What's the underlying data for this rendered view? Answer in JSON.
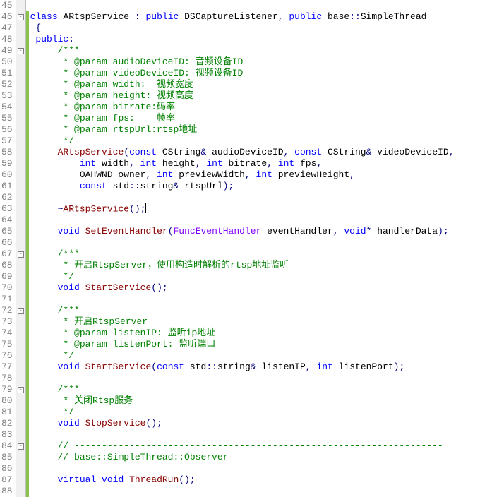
{
  "lines": [
    {
      "num": "45",
      "changed": false,
      "fold": "",
      "tokens": []
    },
    {
      "num": "46",
      "changed": true,
      "fold": "-",
      "tokens": [
        {
          "c": "kw",
          "t": "class"
        },
        {
          "c": "txt",
          "t": " "
        },
        {
          "c": "cls",
          "t": "ARtspService"
        },
        {
          "c": "txt",
          "t": " "
        },
        {
          "c": "op",
          "t": ":"
        },
        {
          "c": "txt",
          "t": " "
        },
        {
          "c": "kw",
          "t": "public"
        },
        {
          "c": "txt",
          "t": " "
        },
        {
          "c": "cls",
          "t": "DSCaptureListener"
        },
        {
          "c": "op",
          "t": ","
        },
        {
          "c": "txt",
          "t": " "
        },
        {
          "c": "kw",
          "t": "public"
        },
        {
          "c": "txt",
          "t": " base"
        },
        {
          "c": "op",
          "t": "::"
        },
        {
          "c": "cls",
          "t": "SimpleThread"
        }
      ]
    },
    {
      "num": "47",
      "changed": true,
      "fold": "",
      "tokens": [
        {
          "c": "txt",
          "t": " "
        },
        {
          "c": "op",
          "t": "{"
        }
      ]
    },
    {
      "num": "48",
      "changed": true,
      "fold": "",
      "tokens": [
        {
          "c": "txt",
          "t": " "
        },
        {
          "c": "kw",
          "t": "public"
        },
        {
          "c": "op",
          "t": ":"
        }
      ]
    },
    {
      "num": "49",
      "changed": true,
      "fold": "-",
      "tokens": [
        {
          "c": "txt",
          "t": "     "
        },
        {
          "c": "comment",
          "t": "/***"
        }
      ]
    },
    {
      "num": "50",
      "changed": true,
      "fold": "",
      "tokens": [
        {
          "c": "txt",
          "t": "     "
        },
        {
          "c": "comment",
          "t": " * @param audioDeviceID: 音频设备ID"
        }
      ]
    },
    {
      "num": "51",
      "changed": true,
      "fold": "",
      "tokens": [
        {
          "c": "txt",
          "t": "     "
        },
        {
          "c": "comment",
          "t": " * @param videoDeviceID: 视频设备ID"
        }
      ]
    },
    {
      "num": "52",
      "changed": true,
      "fold": "",
      "tokens": [
        {
          "c": "txt",
          "t": "     "
        },
        {
          "c": "comment",
          "t": " * @param width:  视频宽度"
        }
      ]
    },
    {
      "num": "53",
      "changed": true,
      "fold": "",
      "tokens": [
        {
          "c": "txt",
          "t": "     "
        },
        {
          "c": "comment",
          "t": " * @param height: 视频高度"
        }
      ]
    },
    {
      "num": "54",
      "changed": true,
      "fold": "",
      "tokens": [
        {
          "c": "txt",
          "t": "     "
        },
        {
          "c": "comment",
          "t": " * @param bitrate:码率"
        }
      ]
    },
    {
      "num": "55",
      "changed": true,
      "fold": "",
      "tokens": [
        {
          "c": "txt",
          "t": "     "
        },
        {
          "c": "comment",
          "t": " * @param fps:    帧率"
        }
      ]
    },
    {
      "num": "56",
      "changed": true,
      "fold": "",
      "tokens": [
        {
          "c": "txt",
          "t": "     "
        },
        {
          "c": "comment",
          "t": " * @param rtspUrl:rtsp地址"
        }
      ]
    },
    {
      "num": "57",
      "changed": true,
      "fold": "",
      "tokens": [
        {
          "c": "txt",
          "t": "     "
        },
        {
          "c": "comment",
          "t": " */"
        }
      ]
    },
    {
      "num": "58",
      "changed": true,
      "fold": "",
      "tokens": [
        {
          "c": "txt",
          "t": "     "
        },
        {
          "c": "func",
          "t": "ARtspService"
        },
        {
          "c": "op",
          "t": "("
        },
        {
          "c": "kw",
          "t": "const"
        },
        {
          "c": "txt",
          "t": " CString"
        },
        {
          "c": "op",
          "t": "&"
        },
        {
          "c": "txt",
          "t": " audioDeviceID"
        },
        {
          "c": "op",
          "t": ","
        },
        {
          "c": "txt",
          "t": " "
        },
        {
          "c": "kw",
          "t": "const"
        },
        {
          "c": "txt",
          "t": " CString"
        },
        {
          "c": "op",
          "t": "&"
        },
        {
          "c": "txt",
          "t": " videoDeviceID"
        },
        {
          "c": "op",
          "t": ","
        }
      ]
    },
    {
      "num": "59",
      "changed": true,
      "fold": "",
      "tokens": [
        {
          "c": "txt",
          "t": "         "
        },
        {
          "c": "kw",
          "t": "int"
        },
        {
          "c": "txt",
          "t": " width"
        },
        {
          "c": "op",
          "t": ","
        },
        {
          "c": "txt",
          "t": " "
        },
        {
          "c": "kw",
          "t": "int"
        },
        {
          "c": "txt",
          "t": " height"
        },
        {
          "c": "op",
          "t": ","
        },
        {
          "c": "txt",
          "t": " "
        },
        {
          "c": "kw",
          "t": "int"
        },
        {
          "c": "txt",
          "t": " bitrate"
        },
        {
          "c": "op",
          "t": ","
        },
        {
          "c": "txt",
          "t": " "
        },
        {
          "c": "kw",
          "t": "int"
        },
        {
          "c": "txt",
          "t": " fps"
        },
        {
          "c": "op",
          "t": ","
        }
      ]
    },
    {
      "num": "60",
      "changed": true,
      "fold": "",
      "tokens": [
        {
          "c": "txt",
          "t": "         OAHWND owner"
        },
        {
          "c": "op",
          "t": ","
        },
        {
          "c": "txt",
          "t": " "
        },
        {
          "c": "kw",
          "t": "int"
        },
        {
          "c": "txt",
          "t": " previewWidth"
        },
        {
          "c": "op",
          "t": ","
        },
        {
          "c": "txt",
          "t": " "
        },
        {
          "c": "kw",
          "t": "int"
        },
        {
          "c": "txt",
          "t": " previewHeight"
        },
        {
          "c": "op",
          "t": ","
        }
      ]
    },
    {
      "num": "61",
      "changed": true,
      "fold": "",
      "tokens": [
        {
          "c": "txt",
          "t": "         "
        },
        {
          "c": "kw",
          "t": "const"
        },
        {
          "c": "txt",
          "t": " std"
        },
        {
          "c": "op",
          "t": "::"
        },
        {
          "c": "txt",
          "t": "string"
        },
        {
          "c": "op",
          "t": "&"
        },
        {
          "c": "txt",
          "t": " rtspUrl"
        },
        {
          "c": "op",
          "t": ");"
        }
      ]
    },
    {
      "num": "62",
      "changed": true,
      "fold": "",
      "tokens": []
    },
    {
      "num": "63",
      "changed": true,
      "fold": "",
      "caret": true,
      "tokens": [
        {
          "c": "txt",
          "t": "     "
        },
        {
          "c": "op",
          "t": "~"
        },
        {
          "c": "func",
          "t": "ARtspService"
        },
        {
          "c": "op",
          "t": "();"
        }
      ]
    },
    {
      "num": "64",
      "changed": true,
      "fold": "",
      "tokens": []
    },
    {
      "num": "65",
      "changed": true,
      "fold": "",
      "tokens": [
        {
          "c": "txt",
          "t": "     "
        },
        {
          "c": "kw",
          "t": "void"
        },
        {
          "c": "txt",
          "t": " "
        },
        {
          "c": "func",
          "t": "SetEventHandler"
        },
        {
          "c": "op",
          "t": "("
        },
        {
          "c": "type",
          "t": "FuncEventHandler"
        },
        {
          "c": "txt",
          "t": " eventHandler"
        },
        {
          "c": "op",
          "t": ","
        },
        {
          "c": "txt",
          "t": " "
        },
        {
          "c": "kw",
          "t": "void"
        },
        {
          "c": "op",
          "t": "*"
        },
        {
          "c": "txt",
          "t": " handlerData"
        },
        {
          "c": "op",
          "t": ");"
        }
      ]
    },
    {
      "num": "66",
      "changed": true,
      "fold": "",
      "tokens": []
    },
    {
      "num": "67",
      "changed": true,
      "fold": "-",
      "tokens": [
        {
          "c": "txt",
          "t": "     "
        },
        {
          "c": "comment",
          "t": "/***"
        }
      ]
    },
    {
      "num": "68",
      "changed": true,
      "fold": "",
      "tokens": [
        {
          "c": "txt",
          "t": "     "
        },
        {
          "c": "comment",
          "t": " * 开启RtspServer，使用构造时解析的rtsp地址监听"
        }
      ]
    },
    {
      "num": "69",
      "changed": true,
      "fold": "",
      "tokens": [
        {
          "c": "txt",
          "t": "     "
        },
        {
          "c": "comment",
          "t": " */"
        }
      ]
    },
    {
      "num": "70",
      "changed": true,
      "fold": "",
      "tokens": [
        {
          "c": "txt",
          "t": "     "
        },
        {
          "c": "kw",
          "t": "void"
        },
        {
          "c": "txt",
          "t": " "
        },
        {
          "c": "func",
          "t": "StartService"
        },
        {
          "c": "op",
          "t": "();"
        }
      ]
    },
    {
      "num": "71",
      "changed": true,
      "fold": "",
      "tokens": []
    },
    {
      "num": "72",
      "changed": true,
      "fold": "-",
      "tokens": [
        {
          "c": "txt",
          "t": "     "
        },
        {
          "c": "comment",
          "t": "/***"
        }
      ]
    },
    {
      "num": "73",
      "changed": true,
      "fold": "",
      "tokens": [
        {
          "c": "txt",
          "t": "     "
        },
        {
          "c": "comment",
          "t": " * 开启RtspServer"
        }
      ]
    },
    {
      "num": "74",
      "changed": true,
      "fold": "",
      "tokens": [
        {
          "c": "txt",
          "t": "     "
        },
        {
          "c": "comment",
          "t": " * @param listenIP: 监听ip地址"
        }
      ]
    },
    {
      "num": "75",
      "changed": true,
      "fold": "",
      "tokens": [
        {
          "c": "txt",
          "t": "     "
        },
        {
          "c": "comment",
          "t": " * @param listenPort: 监听端口"
        }
      ]
    },
    {
      "num": "76",
      "changed": true,
      "fold": "",
      "tokens": [
        {
          "c": "txt",
          "t": "     "
        },
        {
          "c": "comment",
          "t": " */"
        }
      ]
    },
    {
      "num": "77",
      "changed": true,
      "fold": "",
      "tokens": [
        {
          "c": "txt",
          "t": "     "
        },
        {
          "c": "kw",
          "t": "void"
        },
        {
          "c": "txt",
          "t": " "
        },
        {
          "c": "func",
          "t": "StartService"
        },
        {
          "c": "op",
          "t": "("
        },
        {
          "c": "kw",
          "t": "const"
        },
        {
          "c": "txt",
          "t": " std"
        },
        {
          "c": "op",
          "t": "::"
        },
        {
          "c": "txt",
          "t": "string"
        },
        {
          "c": "op",
          "t": "&"
        },
        {
          "c": "txt",
          "t": " listenIP"
        },
        {
          "c": "op",
          "t": ","
        },
        {
          "c": "txt",
          "t": " "
        },
        {
          "c": "kw",
          "t": "int"
        },
        {
          "c": "txt",
          "t": " listenPort"
        },
        {
          "c": "op",
          "t": ");"
        }
      ]
    },
    {
      "num": "78",
      "changed": true,
      "fold": "",
      "tokens": []
    },
    {
      "num": "79",
      "changed": true,
      "fold": "-",
      "tokens": [
        {
          "c": "txt",
          "t": "     "
        },
        {
          "c": "comment",
          "t": "/***"
        }
      ]
    },
    {
      "num": "80",
      "changed": true,
      "fold": "",
      "tokens": [
        {
          "c": "txt",
          "t": "     "
        },
        {
          "c": "comment",
          "t": " * 关闭Rtsp服务"
        }
      ]
    },
    {
      "num": "81",
      "changed": true,
      "fold": "",
      "tokens": [
        {
          "c": "txt",
          "t": "     "
        },
        {
          "c": "comment",
          "t": " */"
        }
      ]
    },
    {
      "num": "82",
      "changed": true,
      "fold": "",
      "tokens": [
        {
          "c": "txt",
          "t": "     "
        },
        {
          "c": "kw",
          "t": "void"
        },
        {
          "c": "txt",
          "t": " "
        },
        {
          "c": "func",
          "t": "StopService"
        },
        {
          "c": "op",
          "t": "();"
        }
      ]
    },
    {
      "num": "83",
      "changed": true,
      "fold": "",
      "tokens": []
    },
    {
      "num": "84",
      "changed": true,
      "fold": "-",
      "tokens": [
        {
          "c": "txt",
          "t": "     "
        },
        {
          "c": "comment",
          "t": "// -------------------------------------------------------------------"
        }
      ]
    },
    {
      "num": "85",
      "changed": true,
      "fold": "",
      "tokens": [
        {
          "c": "txt",
          "t": "     "
        },
        {
          "c": "comment",
          "t": "// base::SimpleThread::Observer"
        }
      ]
    },
    {
      "num": "86",
      "changed": true,
      "fold": "",
      "tokens": []
    },
    {
      "num": "87",
      "changed": true,
      "fold": "",
      "tokens": [
        {
          "c": "txt",
          "t": "     "
        },
        {
          "c": "kw",
          "t": "virtual"
        },
        {
          "c": "txt",
          "t": " "
        },
        {
          "c": "kw",
          "t": "void"
        },
        {
          "c": "txt",
          "t": " "
        },
        {
          "c": "func",
          "t": "ThreadRun"
        },
        {
          "c": "op",
          "t": "();"
        }
      ]
    },
    {
      "num": "88",
      "changed": true,
      "fold": "",
      "tokens": []
    }
  ]
}
